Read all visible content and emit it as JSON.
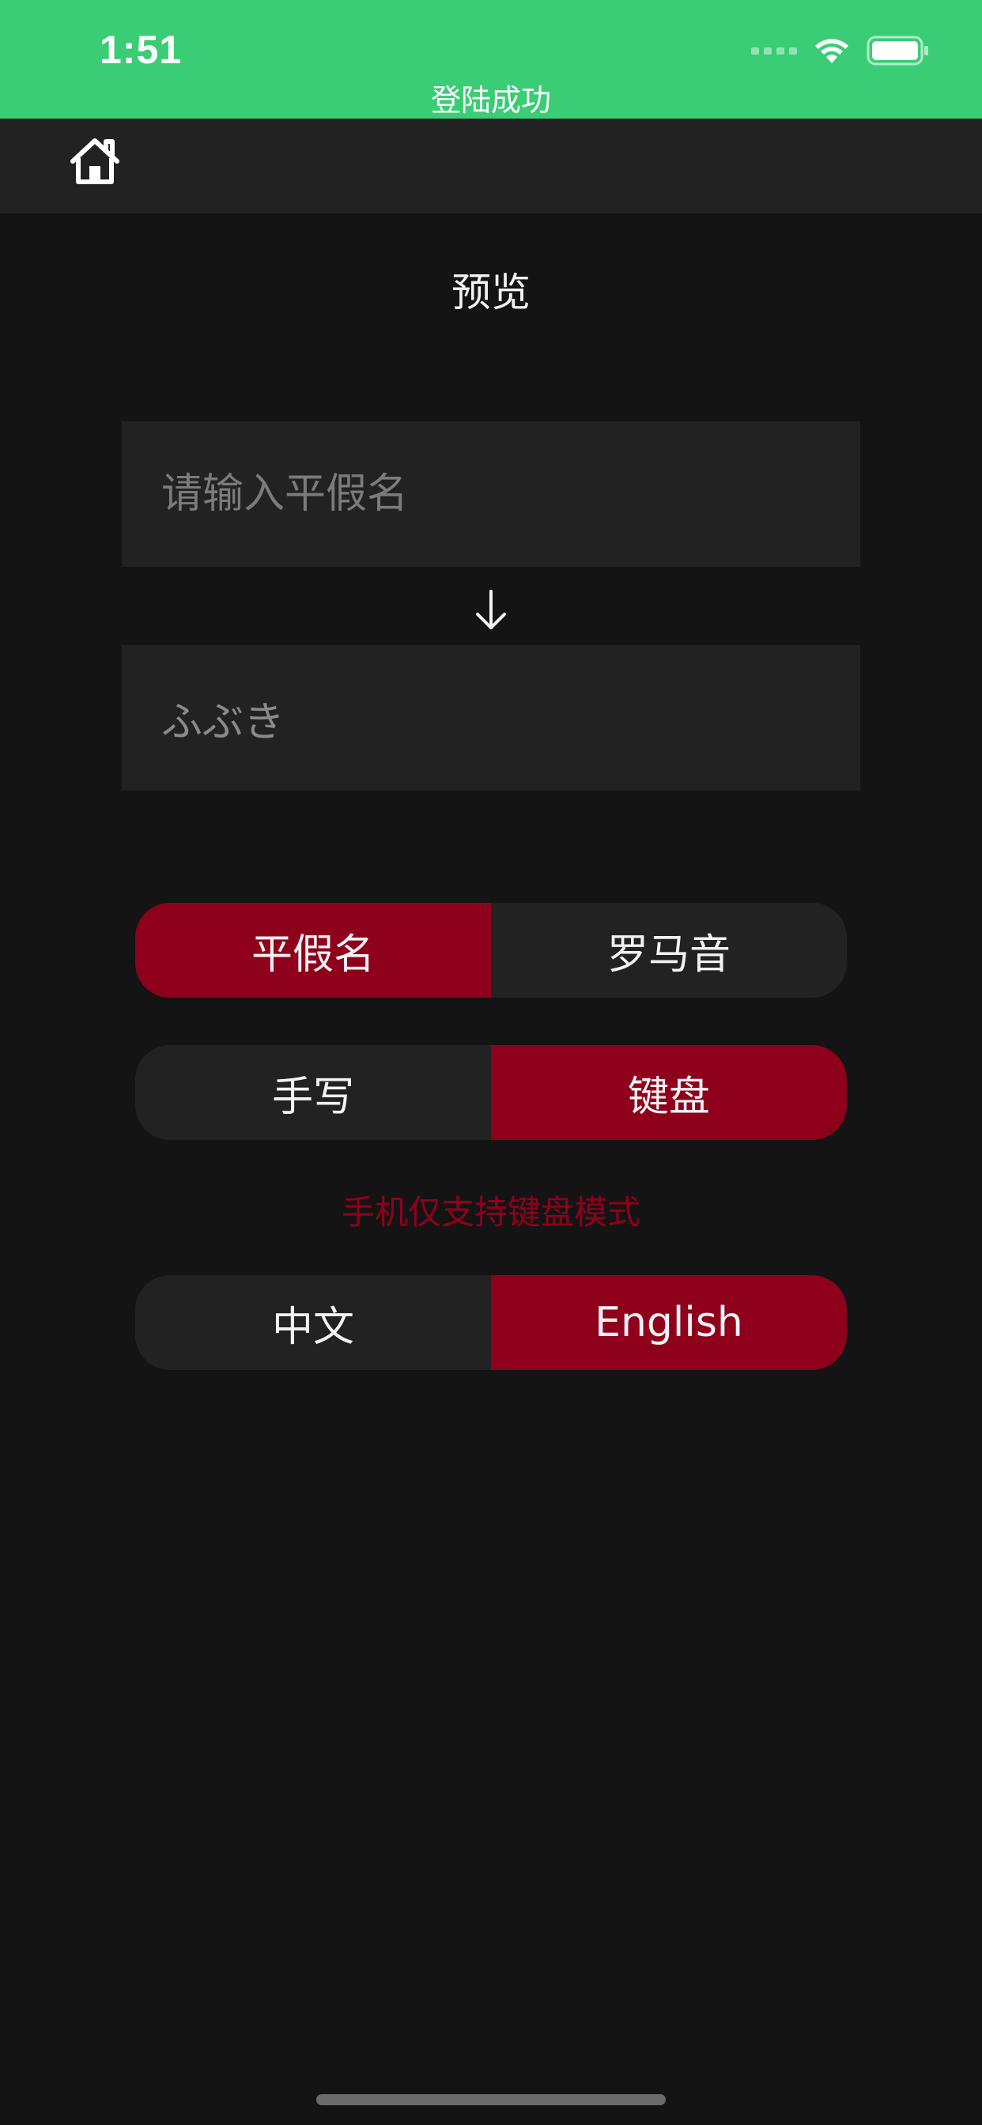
{
  "status_bar": {
    "time": "1:51",
    "banner": "登陆成功",
    "icons": [
      "signal-icon",
      "wifi-icon",
      "battery-icon"
    ]
  },
  "nav": {
    "home_icon": "home-icon"
  },
  "page": {
    "title": "预览"
  },
  "converter": {
    "input_placeholder": "请输入平假名",
    "input_value": "",
    "output_text": "ふぶき",
    "arrow_icon": "arrow-down-icon"
  },
  "script_toggle": {
    "options": [
      "平假名",
      "罗马音"
    ],
    "selected": "平假名"
  },
  "input_mode_toggle": {
    "options": [
      "手写",
      "键盘"
    ],
    "selected": "键盘"
  },
  "notice": "手机仅支持键盘模式",
  "language_toggle": {
    "options": [
      "中文",
      "English"
    ],
    "selected": "English"
  },
  "colors": {
    "status_bar": "#3acd75",
    "accent": "#8f001c",
    "background": "#141414",
    "surface": "#222222"
  }
}
